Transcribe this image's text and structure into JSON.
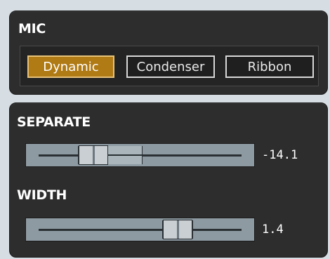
{
  "mic": {
    "title": "MIC",
    "options": [
      "Dynamic",
      "Condenser",
      "Ribbon"
    ],
    "selected": "Dynamic"
  },
  "separate": {
    "title": "SEPARATE",
    "value_text": "-14.1"
  },
  "width": {
    "title": "WIDTH",
    "value_text": "1.4"
  },
  "colors": {
    "panel_bg": "#2d2d2d",
    "active_button": "#b07a14",
    "slider_bg": "#8d9aa1",
    "slider_handle": "#c9cfd2"
  }
}
